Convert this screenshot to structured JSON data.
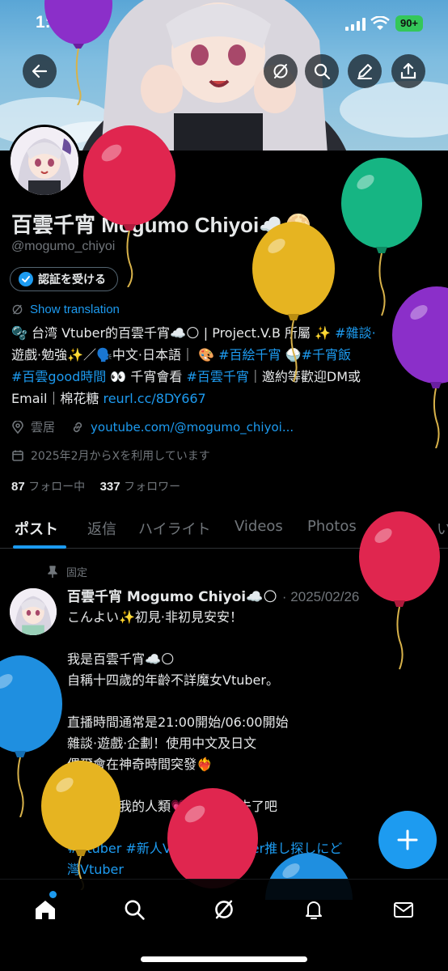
{
  "status_bar": {
    "time": "1:10",
    "battery": "90+"
  },
  "header_actions": [
    "back-icon",
    "grok-icon",
    "search-icon",
    "edit-icon",
    "share-icon"
  ],
  "profile": {
    "display_name": "百雲千宵 Mogumo Chiyoi☁️🌕",
    "handle": "@mogumo_chiyoi",
    "verify_button": "認証を受ける",
    "show_translation": "Show translation",
    "bio": {
      "line1_a": "🫧 台湾 Vtuber的百雲千宵☁️🌕 | Project.V.B 所屬 ✨ ",
      "line1_link": "#雜談·",
      "line2_a": "遊戲·勉強✨／🗣️中文·日本語｜ 🎨 ",
      "line2_link1": "#百絵千宵",
      "line2_mid": " 🍚",
      "line2_link2": "#千宵飯",
      "line3_link1": "#百雲good時間",
      "line3_mid": " 👀 千宵會看 ",
      "line3_link2": "#百雲千宵",
      "line3_end": "｜邀約等歡迎DM或",
      "line4_a": "Email｜棉花糖 ",
      "line4_link": "reurl.cc/8DY667"
    },
    "location": "雲居",
    "website": "youtube.com/@mogumo_chiyoi...",
    "joined": "2025年2月からXを利用しています",
    "following_count": "87",
    "following_label": "フォロー中",
    "followers_count": "337",
    "followers_label": "フォロワー"
  },
  "tabs": [
    "ポスト",
    "返信",
    "ハイライト",
    "Videos",
    "Photos",
    "記事",
    "い"
  ],
  "pinned_post": {
    "pinned_label": "固定",
    "author": "百雲千宵 Mogumo Chiyoi☁️🌕",
    "date": "· 2025/02/26",
    "lines": [
      "こんよい✨初見·非初見安安！",
      "",
      "我是百雲千宵☁️🌕",
      "自稱十四歲的年齡不詳魔女Vtuber。",
      "",
      "直播時間通常是21:00開始/06:00開始",
      "雜談·遊戲·企劃！使用中文及日文",
      "偶爾會在神奇時間突發❤️‍🔥",
      "",
      "有緣看到我的人類💗追蹤點下去了吧",
      ""
    ],
    "hashtags_line1": "#Vtuber #新人Vtuber #Vtuber推し探しにど",
    "hashtags_line2": "灣Vtuber"
  },
  "bottom_nav": [
    "home-icon",
    "search-icon",
    "grok-icon",
    "notifications-icon",
    "messages-icon"
  ],
  "colors": {
    "accent": "#1d9bf0",
    "background": "#000000",
    "muted": "#71767b",
    "text": "#e7e9ea"
  }
}
